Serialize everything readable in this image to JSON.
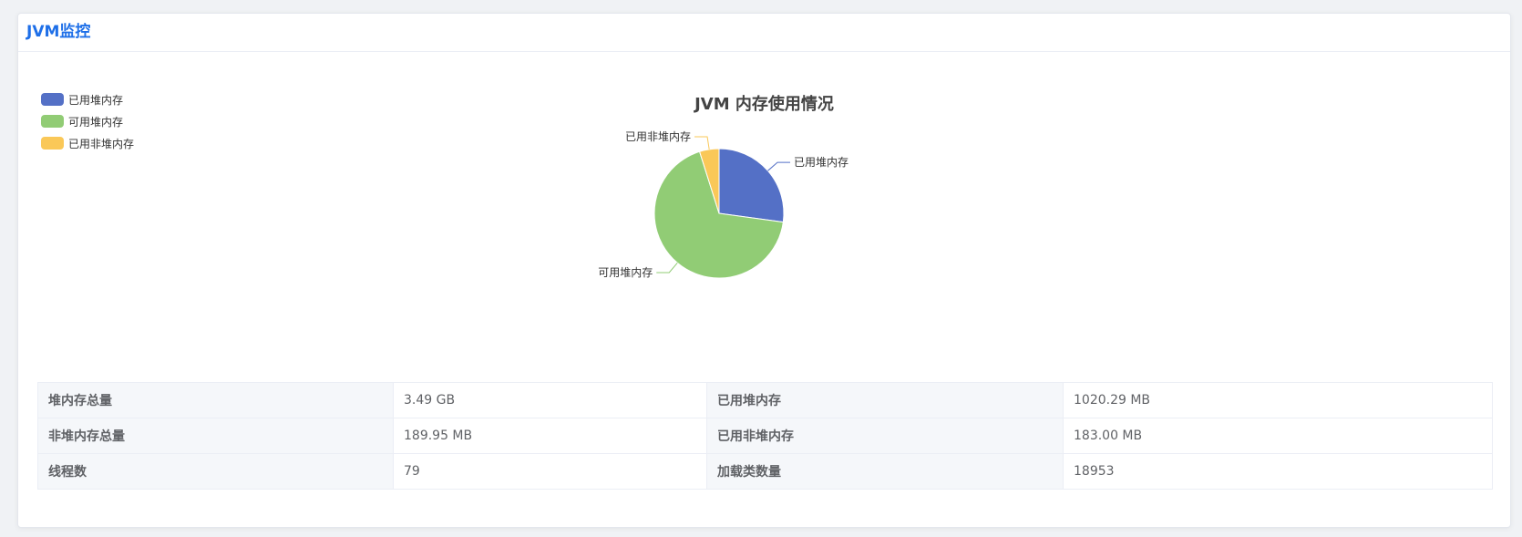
{
  "header": {
    "title": "JVM监控"
  },
  "chart_data": {
    "type": "pie",
    "title": "JVM 内存使用情况",
    "legend_position": "top-left",
    "slices": [
      {
        "name": "已用堆内存",
        "value": 1020.29,
        "color": "#5470c6"
      },
      {
        "name": "可用堆内存",
        "value": 2553.47,
        "color": "#91cc75"
      },
      {
        "name": "已用非堆内存",
        "value": 183.0,
        "color": "#fac858"
      }
    ]
  },
  "table": {
    "rows": [
      [
        {
          "label": "堆内存总量",
          "value": "3.49 GB"
        },
        {
          "label": "已用堆内存",
          "value": "1020.29 MB"
        }
      ],
      [
        {
          "label": "非堆内存总量",
          "value": "189.95 MB"
        },
        {
          "label": "已用非堆内存",
          "value": "183.00 MB"
        }
      ],
      [
        {
          "label": "线程数",
          "value": "79"
        },
        {
          "label": "加载类数量",
          "value": "18953"
        }
      ]
    ]
  }
}
